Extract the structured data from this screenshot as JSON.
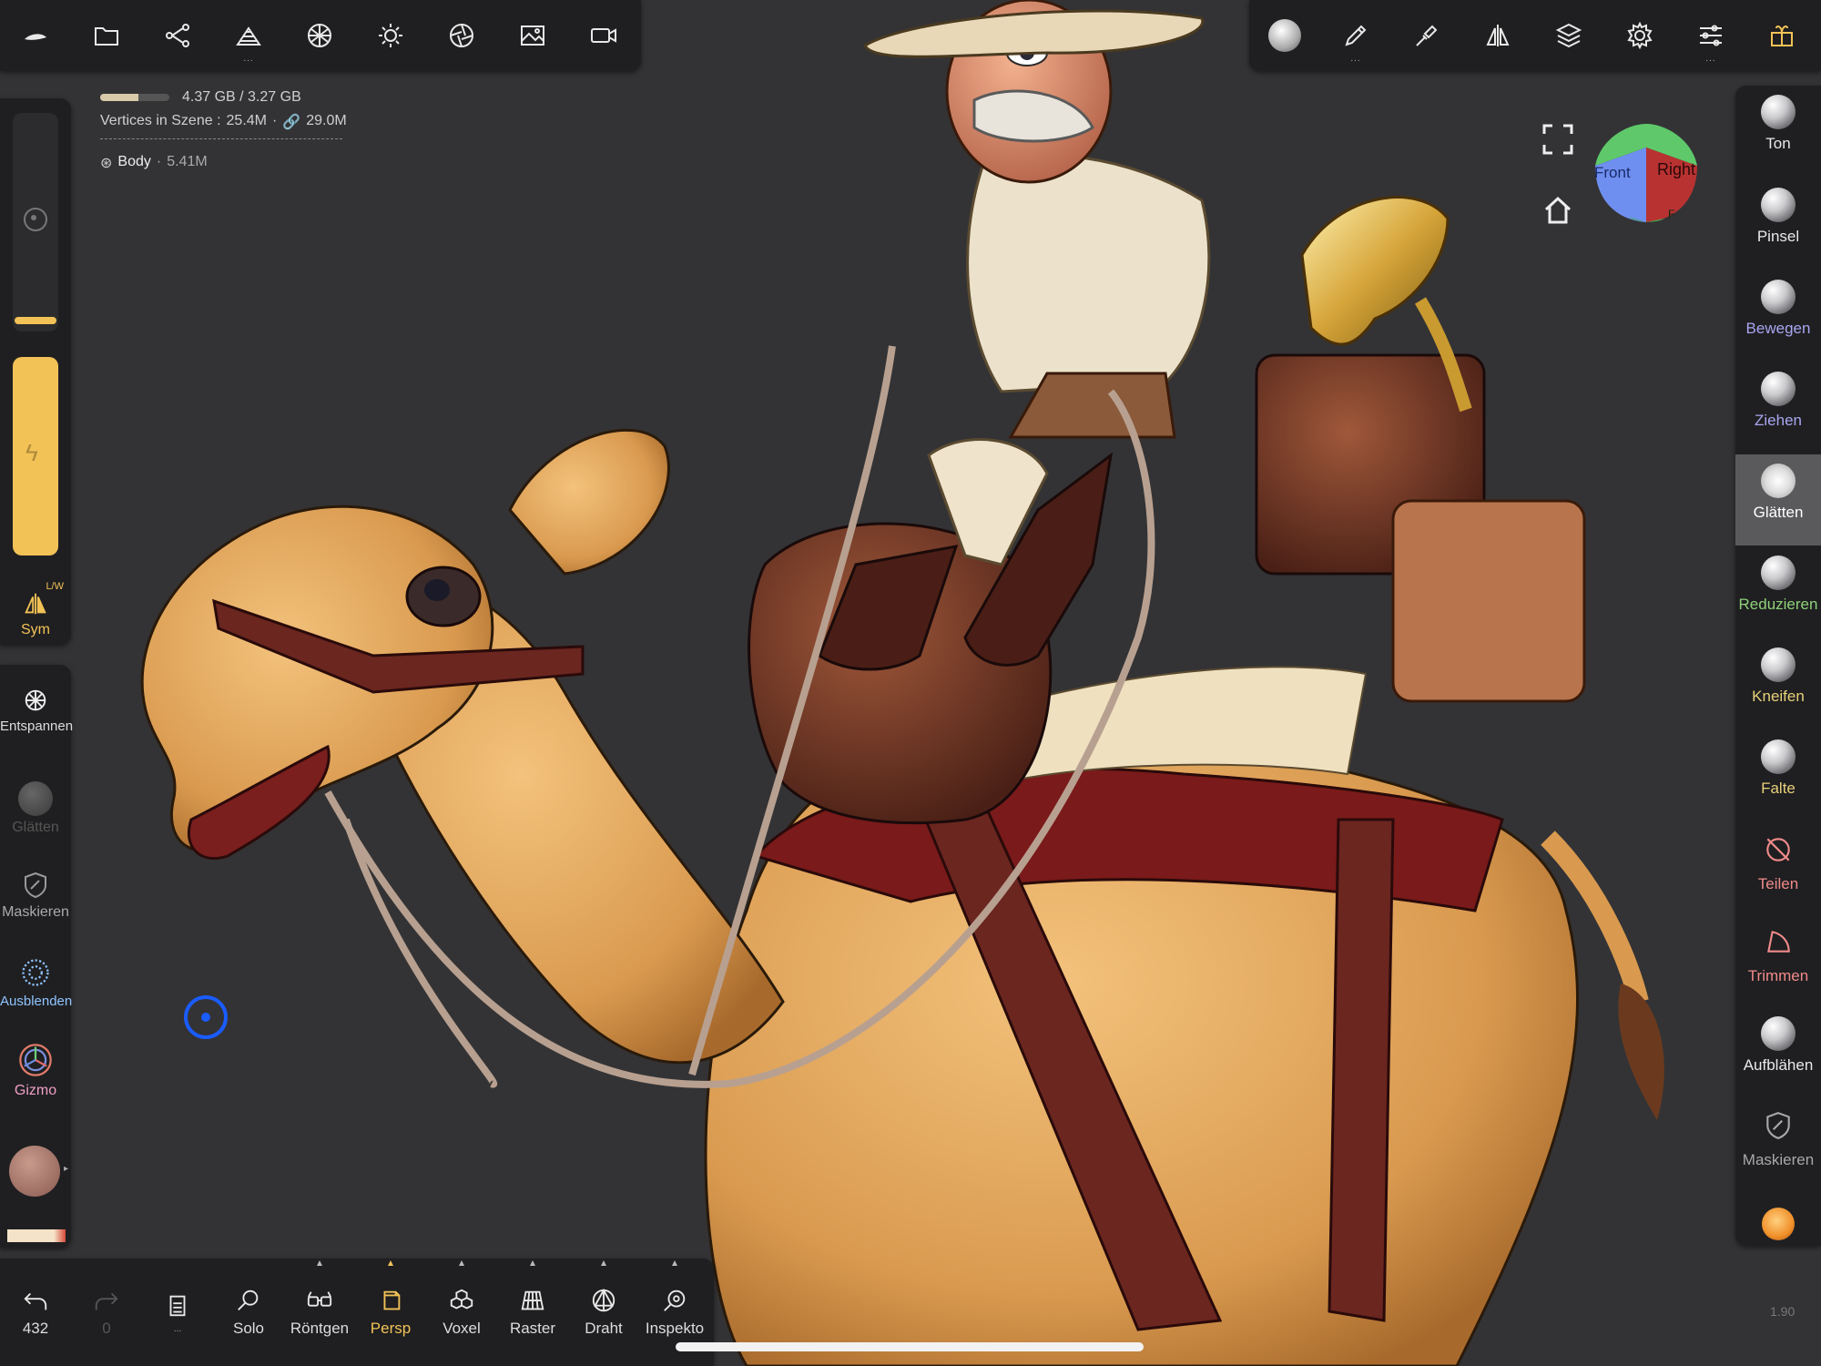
{
  "status": {
    "memory": "4.37 GB / 3.27 GB",
    "memory_fill": 0.55,
    "vertices_label": "Vertices in Szene :",
    "vertices_value": "25.4M",
    "vertices_linked": "29.0M",
    "object_name": "Body",
    "object_count": "5.41M"
  },
  "left": {
    "sym_label": "Sym",
    "sym_badge": "L/W",
    "relax_label": "Entspannen",
    "smooth_label": "Glätten",
    "mask_label": "Maskieren",
    "hide_label": "Ausblenden",
    "gizmo_label": "Gizmo"
  },
  "right_tools": [
    {
      "label": "Ton",
      "color": "#e8e8e8"
    },
    {
      "label": "Pinsel",
      "color": "#e8e8e8"
    },
    {
      "label": "Bewegen",
      "color": "#a9a6f0"
    },
    {
      "label": "Ziehen",
      "color": "#a9a6f0"
    },
    {
      "label": "Glätten",
      "color": "#ffffff"
    },
    {
      "label": "Reduzieren",
      "color": "#8fd17a"
    },
    {
      "label": "Kneifen",
      "color": "#e8d07a"
    },
    {
      "label": "Falte",
      "color": "#e8d07a"
    },
    {
      "label": "Teilen",
      "color": "#f08a8a"
    },
    {
      "label": "Trimmen",
      "color": "#f08a8a"
    },
    {
      "label": "Aufblähen",
      "color": "#e8e8e8"
    },
    {
      "label": "Maskieren",
      "color": "#a8a8a8"
    }
  ],
  "bottom": {
    "undo_count": "432",
    "redo_count": "0",
    "solo": "Solo",
    "xray": "Röntgen",
    "persp": "Persp",
    "voxel": "Voxel",
    "grid": "Raster",
    "wire": "Draht",
    "inspect": "Inspekto"
  },
  "cube": {
    "front": "Front",
    "right": "Right",
    "top": "",
    "bottom": "F"
  },
  "version": "1.90",
  "colors": {
    "accent": "#f2c256",
    "active_tool_bg": "#5a5a5d",
    "persp": "#f2c256",
    "hide": "#8fc4ff"
  }
}
